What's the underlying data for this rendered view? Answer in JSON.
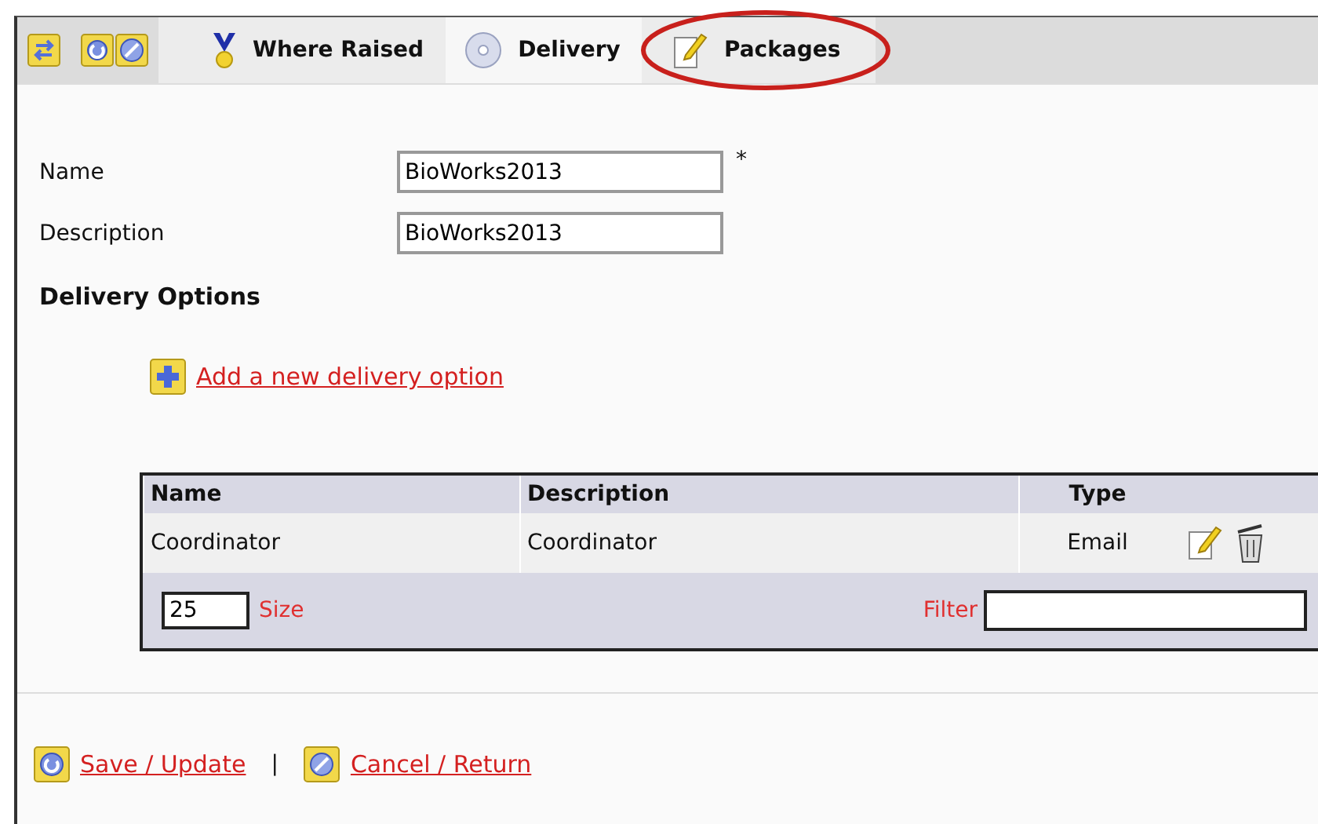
{
  "toolbar_buttons": [
    {
      "kind": "swap"
    },
    {
      "kind": "refresh"
    },
    {
      "kind": "cancel"
    }
  ],
  "tabs": [
    {
      "label": "Where Raised",
      "kind": "medal",
      "selected": false,
      "highlighted": false
    },
    {
      "label": "Delivery",
      "kind": "disc",
      "selected": true,
      "highlighted": false
    },
    {
      "label": "Packages",
      "kind": "note",
      "selected": false,
      "highlighted": true
    }
  ],
  "fields": [
    {
      "label": "Name",
      "value": "BioWorks2013",
      "required_mark": "*"
    },
    {
      "label": "Description",
      "value": "BioWorks2013"
    }
  ],
  "section_title": "Delivery Options",
  "add_link": "Add a new delivery option",
  "table": {
    "columns": [
      "Name",
      "Description",
      "Type"
    ],
    "rows": [
      {
        "cells": [
          "Coordinator",
          "Coordinator",
          "Email"
        ]
      }
    ],
    "page_size": "25",
    "size_label": "Size",
    "filter_label": "Filter"
  },
  "footer": {
    "save": "Save / Update",
    "separator": "|",
    "cancel": "Cancel / Return"
  }
}
